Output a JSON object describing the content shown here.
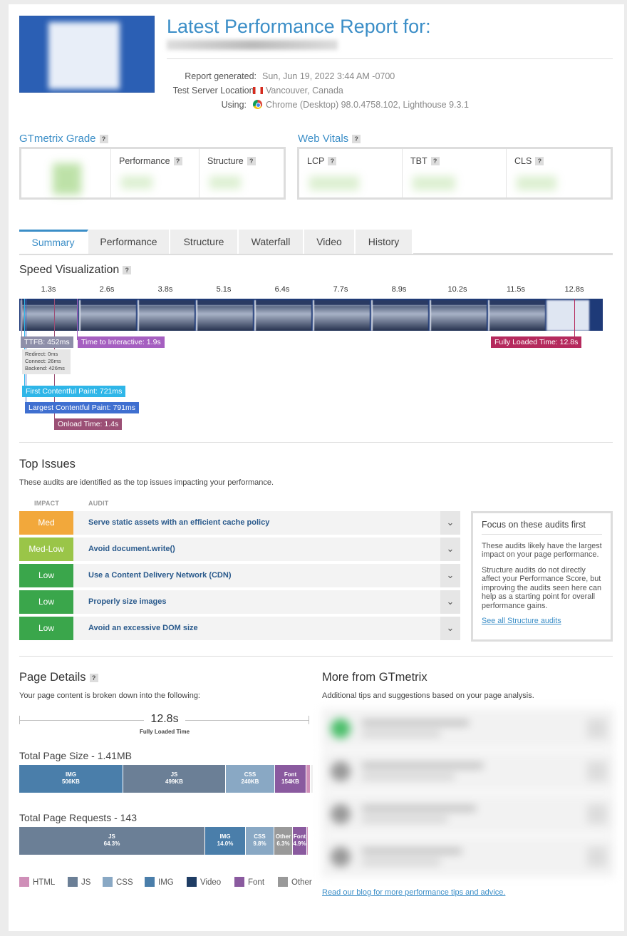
{
  "header": {
    "title": "Latest Performance Report for:",
    "meta": [
      {
        "label": "Report generated:",
        "value": "Sun, Jun 19, 2022 3:44 AM -0700",
        "icon": ""
      },
      {
        "label": "Test Server Location:",
        "value": "Vancouver, Canada",
        "icon": "canada-flag-icon"
      },
      {
        "label": "Using:",
        "value": "Chrome (Desktop) 98.0.4758.102, Lighthouse 9.3.1",
        "icon": "chrome-icon"
      }
    ]
  },
  "grade": {
    "title": "GTmetrix Grade",
    "help": "?",
    "performance_label": "Performance",
    "structure_label": "Structure"
  },
  "vitals": {
    "title": "Web Vitals",
    "help": "?",
    "lcp_label": "LCP",
    "tbt_label": "TBT",
    "cls_label": "CLS"
  },
  "tabs": [
    {
      "label": "Summary",
      "active": true
    },
    {
      "label": "Performance",
      "active": false
    },
    {
      "label": "Structure",
      "active": false
    },
    {
      "label": "Waterfall",
      "active": false
    },
    {
      "label": "Video",
      "active": false
    },
    {
      "label": "History",
      "active": false
    }
  ],
  "speed": {
    "title": "Speed Visualization",
    "help": "?",
    "ticks": [
      "1.3s",
      "2.6s",
      "3.8s",
      "5.1s",
      "6.4s",
      "7.7s",
      "8.9s",
      "10.2s",
      "11.5s",
      "12.8s"
    ],
    "markers": {
      "ttfb": "TTFB: 452ms",
      "tti": "Time to Interactive: 1.9s",
      "fully_loaded": "Fully Loaded Time: 12.8s",
      "fcp": "First Contentful Paint: 721ms",
      "lcp": "Largest Contentful Paint: 791ms",
      "onload": "Onload Time: 1.4s"
    },
    "ttfb_detail": [
      "Redirect: 0ms",
      "Connect: 26ms",
      "Backend: 426ms"
    ],
    "colors": {
      "ttfb": "#8e8fa9",
      "tti": "#a55fc0",
      "fully_loaded": "#b52a5d",
      "fcp": "#2fb6e8",
      "lcp": "#3f6fd0",
      "onload": "#9b4f75"
    }
  },
  "issues": {
    "title": "Top Issues",
    "subtitle": "These audits are identified as the top issues impacting your performance.",
    "col_impact": "IMPACT",
    "col_audit": "AUDIT",
    "rows": [
      {
        "impact": "Med",
        "audit": "Serve static assets with an efficient cache policy",
        "color": "#f2a83b"
      },
      {
        "impact": "Med-Low",
        "audit": "Avoid document.write()",
        "color": "#9ac548"
      },
      {
        "impact": "Low",
        "audit": "Use a Content Delivery Network (CDN)",
        "color": "#3aa64b"
      },
      {
        "impact": "Low",
        "audit": "Properly size images",
        "color": "#3aa64b"
      },
      {
        "impact": "Low",
        "audit": "Avoid an excessive DOM size",
        "color": "#3aa64b"
      }
    ],
    "focus": {
      "title": "Focus on these audits first",
      "p1": "These audits likely have the largest impact on your page performance.",
      "p2": "Structure audits do not directly affect your Performance Score, but improving the audits seen here can help as a starting point for overall performance gains.",
      "link": "See all Structure audits"
    }
  },
  "details": {
    "title": "Page Details",
    "help": "?",
    "subtitle": "Your page content is broken down into the following:",
    "fully_loaded_value": "12.8s",
    "fully_loaded_label": "Fully Loaded Time",
    "size_title": "Total Page Size - 1.41MB",
    "size_segments": [
      {
        "type": "IMG",
        "value": "506KB",
        "share": 0.359,
        "color": "#4a7eaa"
      },
      {
        "type": "JS",
        "value": "499KB",
        "share": 0.354,
        "color": "#6b7f96"
      },
      {
        "type": "CSS",
        "value": "240KB",
        "share": 0.17,
        "color": "#89a8c4"
      },
      {
        "type": "Font",
        "value": "154KB",
        "share": 0.109,
        "color": "#8a5a9f"
      },
      {
        "type": "",
        "value": "",
        "share": 0.016,
        "color": "#cf8fb8"
      },
      {
        "type": "",
        "value": "",
        "share": 0.009,
        "color": "#f0f0f0"
      },
      {
        "type": "",
        "value": "",
        "share": 0.012,
        "color": "#999999"
      }
    ],
    "requests_title": "Total Page Requests - 143",
    "request_segments": [
      {
        "type": "JS",
        "value": "64.3%",
        "share": 0.643,
        "color": "#6b7f96"
      },
      {
        "type": "IMG",
        "value": "14.0%",
        "share": 0.14,
        "color": "#4a7eaa"
      },
      {
        "type": "CSS",
        "value": "9.8%",
        "share": 0.098,
        "color": "#89a8c4"
      },
      {
        "type": "Other",
        "value": "6.3%",
        "share": 0.063,
        "color": "#999999"
      },
      {
        "type": "Font",
        "value": "4.9%",
        "share": 0.049,
        "color": "#8a5a9f"
      },
      {
        "type": "",
        "value": "",
        "share": 0.007,
        "color": "#cf8fb8"
      }
    ],
    "legend": [
      {
        "label": "HTML",
        "color": "#cf8fb8"
      },
      {
        "label": "JS",
        "color": "#6b7f96"
      },
      {
        "label": "CSS",
        "color": "#89a8c4"
      },
      {
        "label": "IMG",
        "color": "#4a7eaa"
      },
      {
        "label": "Video",
        "color": "#1f3d64"
      },
      {
        "label": "Font",
        "color": "#8a5a9f"
      },
      {
        "label": "Other",
        "color": "#999999"
      }
    ]
  },
  "more": {
    "title": "More from GTmetrix",
    "subtitle": "Additional tips and suggestions based on your page analysis.",
    "link": "Read our blog for more performance tips and advice."
  }
}
